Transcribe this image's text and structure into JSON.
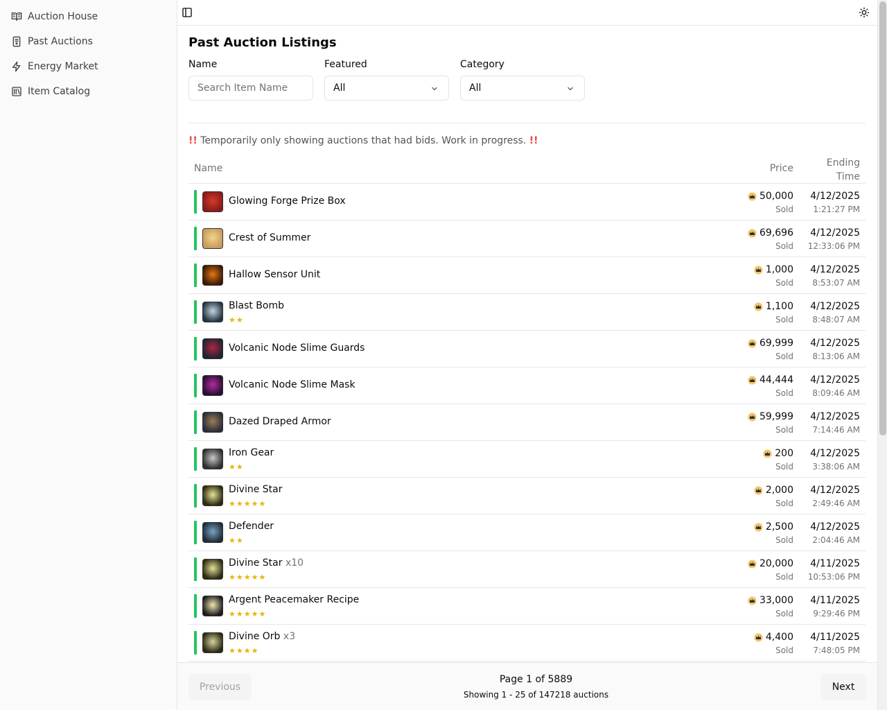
{
  "sidebar": {
    "items": [
      {
        "label": "Auction House",
        "icon": "book-open-icon"
      },
      {
        "label": "Past Auctions",
        "icon": "receipt-icon"
      },
      {
        "label": "Energy Market",
        "icon": "zap-icon"
      },
      {
        "label": "Item Catalog",
        "icon": "library-icon"
      }
    ]
  },
  "topbar": {
    "toggle_icon": "sidebar-toggle-icon",
    "theme_icon": "sun-icon"
  },
  "page": {
    "title": "Past Auction Listings",
    "filters": {
      "name_label": "Name",
      "name_placeholder": "Search Item Name",
      "featured_label": "Featured",
      "featured_value": "All",
      "category_label": "Category",
      "category_value": "All"
    },
    "notice": {
      "bang": "!!",
      "text": " Temporarily only showing auctions that had bids. Work in progress. "
    },
    "table": {
      "headers": {
        "name": "Name",
        "price": "Price",
        "time_line1": "Ending",
        "time_line2": "Time"
      },
      "status_color": "#22c55e",
      "star_color": "#eab308",
      "rows": [
        {
          "name": "Glowing Forge Prize Box",
          "qty": "",
          "stars": 0,
          "price": "50,000",
          "status": "Sold",
          "date": "4/12/2025",
          "time": "1:21:27 PM",
          "thumb": [
            "#8b1a1a",
            "#d13b2a"
          ]
        },
        {
          "name": "Crest of Summer",
          "qty": "",
          "stars": 0,
          "price": "69,696",
          "status": "Sold",
          "date": "4/12/2025",
          "time": "12:33:06 PM",
          "thumb": [
            "#c79a5b",
            "#f1d38f"
          ]
        },
        {
          "name": "Hallow Sensor Unit",
          "qty": "",
          "stars": 0,
          "price": "1,000",
          "status": "Sold",
          "date": "4/12/2025",
          "time": "8:53:07 AM",
          "thumb": [
            "#3a1a06",
            "#e4780f"
          ]
        },
        {
          "name": "Blast Bomb",
          "qty": "",
          "stars": 2,
          "price": "1,100",
          "status": "Sold",
          "date": "4/12/2025",
          "time": "8:48:07 AM",
          "thumb": [
            "#243442",
            "#c3d6e0"
          ]
        },
        {
          "name": "Volcanic Node Slime Guards",
          "qty": "",
          "stars": 0,
          "price": "69,999",
          "status": "Sold",
          "date": "4/12/2025",
          "time": "8:13:06 AM",
          "thumb": [
            "#1e2433",
            "#b0243f"
          ]
        },
        {
          "name": "Volcanic Node Slime Mask",
          "qty": "",
          "stars": 0,
          "price": "44,444",
          "status": "Sold",
          "date": "4/12/2025",
          "time": "8:09:46 AM",
          "thumb": [
            "#2a0f33",
            "#b12ca0"
          ]
        },
        {
          "name": "Dazed Draped Armor",
          "qty": "",
          "stars": 0,
          "price": "59,999",
          "status": "Sold",
          "date": "4/12/2025",
          "time": "7:14:46 AM",
          "thumb": [
            "#2a2f38",
            "#a07a5a"
          ]
        },
        {
          "name": "Iron Gear",
          "qty": "",
          "stars": 2,
          "price": "200",
          "status": "Sold",
          "date": "4/12/2025",
          "time": "3:38:06 AM",
          "thumb": [
            "#2f2f2f",
            "#c8c8c8"
          ]
        },
        {
          "name": "Divine Star",
          "qty": "",
          "stars": 5,
          "price": "2,000",
          "status": "Sold",
          "date": "4/12/2025",
          "time": "2:49:46 AM",
          "thumb": [
            "#2c2a10",
            "#e6e29a"
          ]
        },
        {
          "name": "Defender",
          "qty": "",
          "stars": 2,
          "price": "2,500",
          "status": "Sold",
          "date": "4/12/2025",
          "time": "2:04:46 AM",
          "thumb": [
            "#1f2d3a",
            "#7aa2c2"
          ]
        },
        {
          "name": "Divine Star",
          "qty": "x10",
          "stars": 5,
          "price": "20,000",
          "status": "Sold",
          "date": "4/11/2025",
          "time": "10:53:06 PM",
          "thumb": [
            "#2c2a10",
            "#e6e29a"
          ]
        },
        {
          "name": "Argent Peacemaker Recipe",
          "qty": "",
          "stars": 5,
          "price": "33,000",
          "status": "Sold",
          "date": "4/11/2025",
          "time": "9:29:46 PM",
          "thumb": [
            "#1c1c1c",
            "#f0e6b0"
          ]
        },
        {
          "name": "Divine Orb",
          "qty": "x3",
          "stars": 4,
          "price": "4,400",
          "status": "Sold",
          "date": "4/11/2025",
          "time": "7:48:05 PM",
          "thumb": [
            "#2b2a12",
            "#d8d2a0"
          ]
        }
      ]
    }
  },
  "pagination": {
    "prev_label": "Previous",
    "next_label": "Next",
    "page_text": "Page 1 of 5889",
    "showing_text": "Showing 1 - 25 of 147218 auctions"
  }
}
